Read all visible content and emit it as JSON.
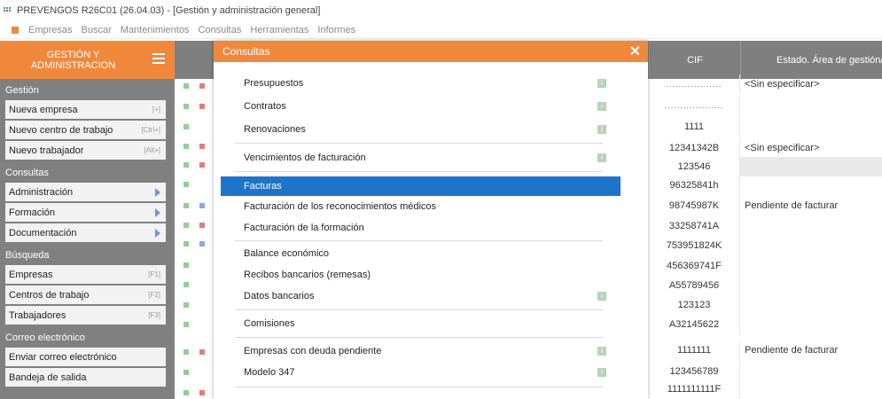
{
  "window": {
    "title": "PREVENGOS R26C01 (26.04.03) - [Gestión y administración general]"
  },
  "menubar": [
    "Empresas",
    "Buscar",
    "Mantenimientos",
    "Consultas",
    "Herramientas",
    "Informes"
  ],
  "sidebar": {
    "header": "GESTIÓN Y\nADMINISTRACION",
    "sections": [
      {
        "label": "Gestión",
        "items": [
          {
            "label": "Nueva empresa",
            "shortcut": "[+]"
          },
          {
            "label": "Nuevo centro de trabajo",
            "shortcut": "[Ctrl+]"
          },
          {
            "label": "Nuevo trabajador",
            "shortcut": "[Alt+]"
          }
        ]
      },
      {
        "label": "Consultas",
        "items": [
          {
            "label": "Administración",
            "arrow": true
          },
          {
            "label": "Formación",
            "arrow": true
          },
          {
            "label": "Documentación",
            "arrow": true
          }
        ]
      },
      {
        "label": "Búsqueda",
        "items": [
          {
            "label": "Empresas",
            "shortcut": "[F1]"
          },
          {
            "label": "Centros de trabajo",
            "shortcut": "[F2]"
          },
          {
            "label": "Trabajadores",
            "shortcut": "[F3]"
          }
        ]
      },
      {
        "label": "Correo electrónico",
        "items": [
          {
            "label": "Enviar correo electrónico"
          },
          {
            "label": "Bandeja de salida"
          }
        ]
      }
    ]
  },
  "grid": {
    "headers": {
      "cif": "CIF",
      "estado": "Estado. Área de gestión/adr"
    },
    "rows": [
      {
        "cif": "..................",
        "estado": "<Sin especificar>"
      },
      {
        "cif": "...................",
        "estado": ""
      },
      {
        "cif": "1111",
        "estado": ""
      },
      {
        "cif": "12341342B",
        "estado": "<Sin especificar>"
      },
      {
        "cif": "123546",
        "estado": ""
      },
      {
        "cif": "96325841h",
        "estado": ""
      },
      {
        "cif": "98745987K",
        "estado": "Pendiente de facturar"
      },
      {
        "cif": "33258741A",
        "estado": ""
      },
      {
        "cif": "753951824K",
        "estado": ""
      },
      {
        "cif": "456369741F",
        "estado": ""
      },
      {
        "cif": "A55789456",
        "estado": ""
      },
      {
        "cif": "123123",
        "estado": ""
      },
      {
        "cif": "A32145622",
        "estado": ""
      },
      {
        "cif": "1111111",
        "estado": "Pendiente de facturar"
      },
      {
        "cif": "123456789",
        "estado": ""
      },
      {
        "cif": "1111111111F",
        "estado": ""
      }
    ]
  },
  "dialog": {
    "title": "Consultas",
    "close": "✕",
    "info_glyph": "i",
    "options": [
      {
        "label": "Presupuestos",
        "info": true
      },
      {
        "label": "Contratos",
        "info": true
      },
      {
        "label": "Renovaciones",
        "info": true
      },
      {
        "label": "Vencimientos de facturación",
        "info": true
      },
      {
        "label": "Facturas",
        "selected": true
      },
      {
        "label": "Facturación de los reconocimientos médicos"
      },
      {
        "label": "Facturación de la formación"
      },
      {
        "label": "Balance económico"
      },
      {
        "label": "Recibos bancarios (remesas)"
      },
      {
        "label": "Datos bancarios",
        "info": true
      },
      {
        "label": "Comisiones"
      },
      {
        "label": "Empresas con deuda pendiente",
        "info": true
      },
      {
        "label": "Modelo 347",
        "info": true
      }
    ]
  },
  "colors": {
    "accent": "#f0883c",
    "selection": "#1e74c8",
    "sidebar": "#808080"
  }
}
